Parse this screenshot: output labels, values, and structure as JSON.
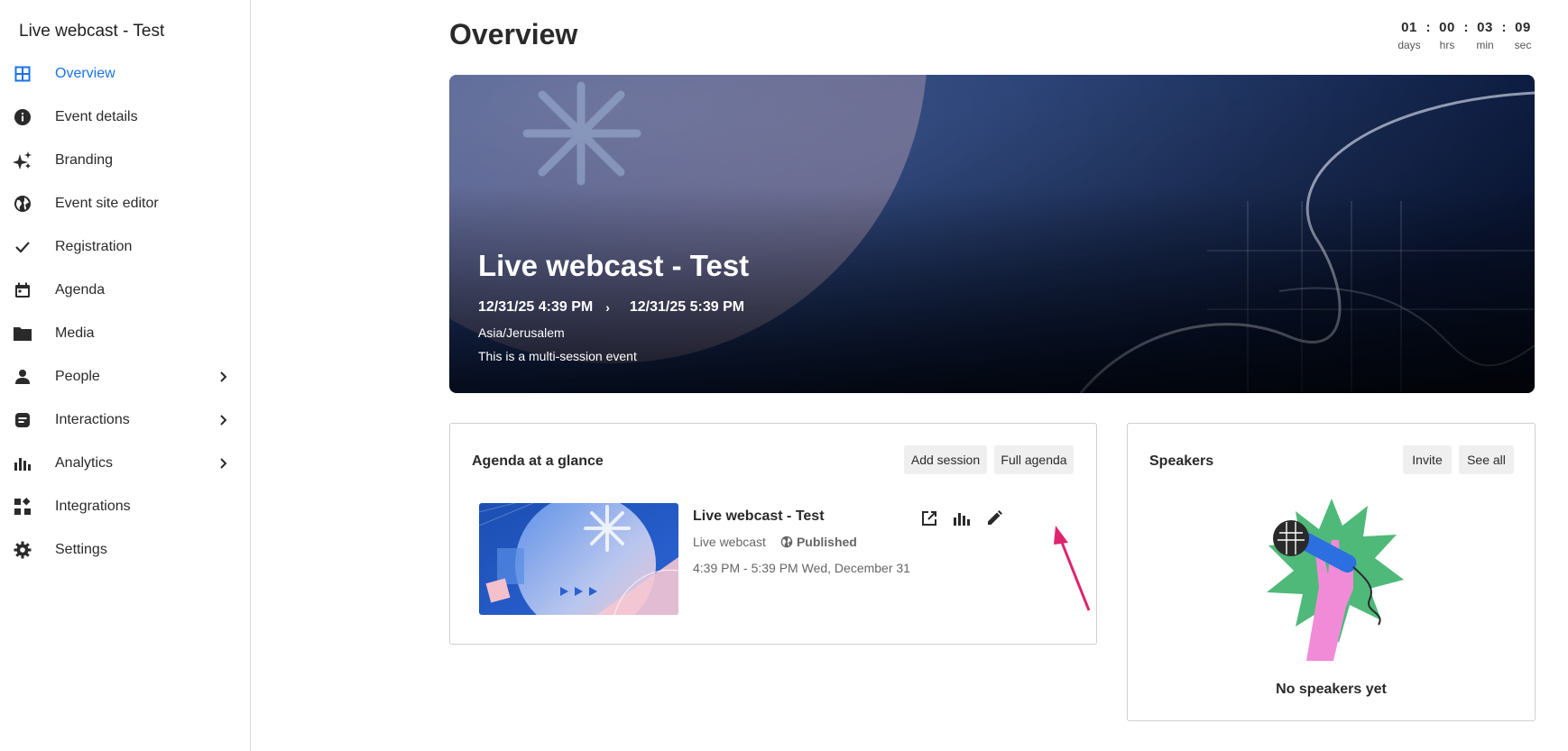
{
  "sidebar": {
    "title": "Live webcast - Test",
    "items": [
      {
        "label": "Overview",
        "icon": "grid-icon",
        "active": true
      },
      {
        "label": "Event details",
        "icon": "info-icon"
      },
      {
        "label": "Branding",
        "icon": "sparkle-icon"
      },
      {
        "label": "Event site editor",
        "icon": "globe-icon"
      },
      {
        "label": "Registration",
        "icon": "check-icon"
      },
      {
        "label": "Agenda",
        "icon": "calendar-icon"
      },
      {
        "label": "Media",
        "icon": "folder-icon"
      },
      {
        "label": "People",
        "icon": "person-icon",
        "expandable": true
      },
      {
        "label": "Interactions",
        "icon": "chat-icon",
        "expandable": true
      },
      {
        "label": "Analytics",
        "icon": "bar-chart-icon",
        "expandable": true
      },
      {
        "label": "Integrations",
        "icon": "apps-icon"
      },
      {
        "label": "Settings",
        "icon": "gear-icon"
      }
    ]
  },
  "header": {
    "title": "Overview",
    "countdown": [
      {
        "value": "01",
        "label": "days"
      },
      {
        "value": "00",
        "label": "hrs"
      },
      {
        "value": "03",
        "label": "min"
      },
      {
        "value": "09",
        "label": "sec"
      }
    ]
  },
  "hero": {
    "title": "Live webcast - Test",
    "start": "12/31/25 4:39 PM",
    "end": "12/31/25 5:39 PM",
    "timezone": "Asia/Jerusalem",
    "note": "This is a multi-session event"
  },
  "agenda": {
    "title": "Agenda at a glance",
    "add_label": "Add session",
    "full_label": "Full agenda",
    "session": {
      "title": "Live webcast - Test",
      "type": "Live webcast",
      "status": "Published",
      "time": "4:39 PM - 5:39 PM Wed, December 31"
    }
  },
  "speakers": {
    "title": "Speakers",
    "invite_label": "Invite",
    "see_all_label": "See all",
    "empty": "No speakers yet"
  },
  "colors": {
    "accent": "#1a73e8",
    "annotation_arrow": "#e0236f",
    "hero_dark": "#060c1f",
    "hero_blue": "#1e3a78"
  }
}
